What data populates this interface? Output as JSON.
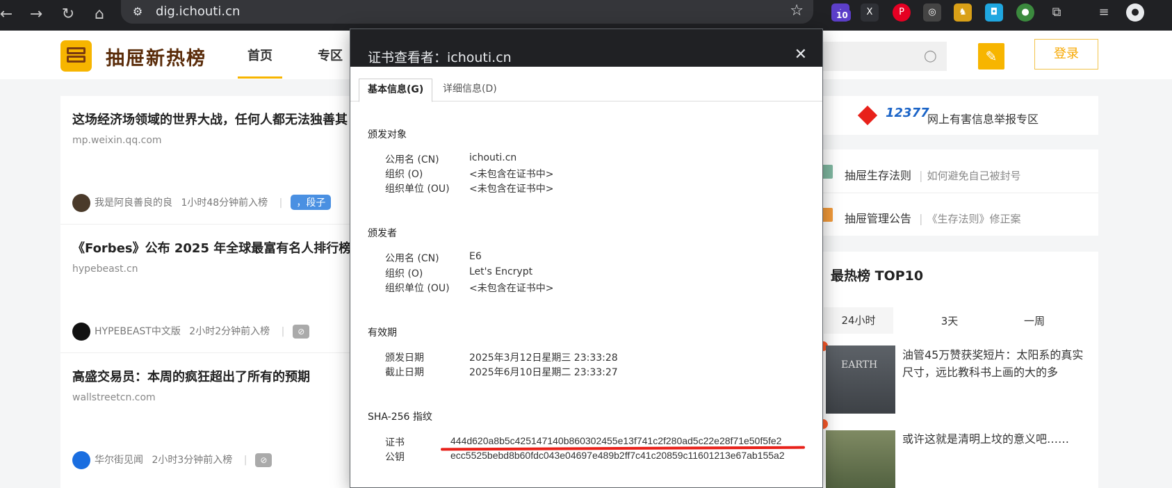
{
  "browser": {
    "url": "dig.ichouti.cn",
    "extension_badge": "10"
  },
  "site": {
    "logo_text": "抽屉新热榜",
    "nav": [
      "首页",
      "专区"
    ],
    "login": "登录"
  },
  "feed": [
    {
      "title": "这场经济场领域的世界大战，任何人都无法独善其",
      "domain": "mp.weixin.qq.com",
      "author": "我是阿良善良的良",
      "time": "1小时48分钟前入榜",
      "tag": "，段子"
    },
    {
      "title": "《Forbes》公布 2025 年全球最富有名人排行榜",
      "domain": "hypebeast.cn",
      "author": "HYPEBEAST中文版",
      "time": "2小时2分钟前入榜",
      "tag": ""
    },
    {
      "title": "高盛交易员：本周的疯狂超出了所有的预期",
      "domain": "wallstreetcn.com",
      "author": "华尔街见闻",
      "time": "2小时3分钟前入榜",
      "tag": ""
    }
  ],
  "right": {
    "report_logo": "12377",
    "report_text": "网上有害信息举报专区",
    "links": [
      {
        "title": "抽屉生存法则",
        "sub": "如何避免自己被封号"
      },
      {
        "title": "抽屉管理公告",
        "sub": "《生存法则》修正案"
      }
    ],
    "hot_title": "最热榜 TOP10",
    "hot_tabs": [
      "24小时",
      "3天",
      "一周"
    ],
    "hot_items": [
      {
        "text": "油管45万赞获奖短片：太阳系的真实尺寸，远比教科书上画的大的多",
        "img_text": "EARTH"
      },
      {
        "text": "或许这就是清明上坟的意义吧……",
        "img_text": ""
      }
    ]
  },
  "modal": {
    "title": "证书查看者：ichouti.cn",
    "tabs": [
      "基本信息(G)",
      "详细信息(D)"
    ],
    "issued_to": {
      "heading": "颁发对象",
      "rows": [
        {
          "k": "公用名 (CN)",
          "v": "ichouti.cn"
        },
        {
          "k": "组织 (O)",
          "v": "<未包含在证书中>"
        },
        {
          "k": "组织单位 (OU)",
          "v": "<未包含在证书中>"
        }
      ]
    },
    "issued_by": {
      "heading": "颁发者",
      "rows": [
        {
          "k": "公用名 (CN)",
          "v": "E6"
        },
        {
          "k": "组织 (O)",
          "v": "Let's Encrypt"
        },
        {
          "k": "组织单位 (OU)",
          "v": "<未包含在证书中>"
        }
      ]
    },
    "validity": {
      "heading": "有效期",
      "rows": [
        {
          "k": "颁发日期",
          "v": "2025年3月12日星期三 23:33:28"
        },
        {
          "k": "截止日期",
          "v": "2025年6月10日星期二 23:33:27"
        }
      ]
    },
    "fingerprints": {
      "heading": "SHA-256 指纹",
      "rows": [
        {
          "k": "证书",
          "v": "444d620a8b5c425147140b860302455e13f741c2f280ad5c22e28f71e50f5fe2"
        },
        {
          "k": "公钥",
          "v": "ecc5525bebd8b60fdc043e04697e489b2ff7c41c20859c11601213e67ab155a2"
        }
      ]
    }
  }
}
